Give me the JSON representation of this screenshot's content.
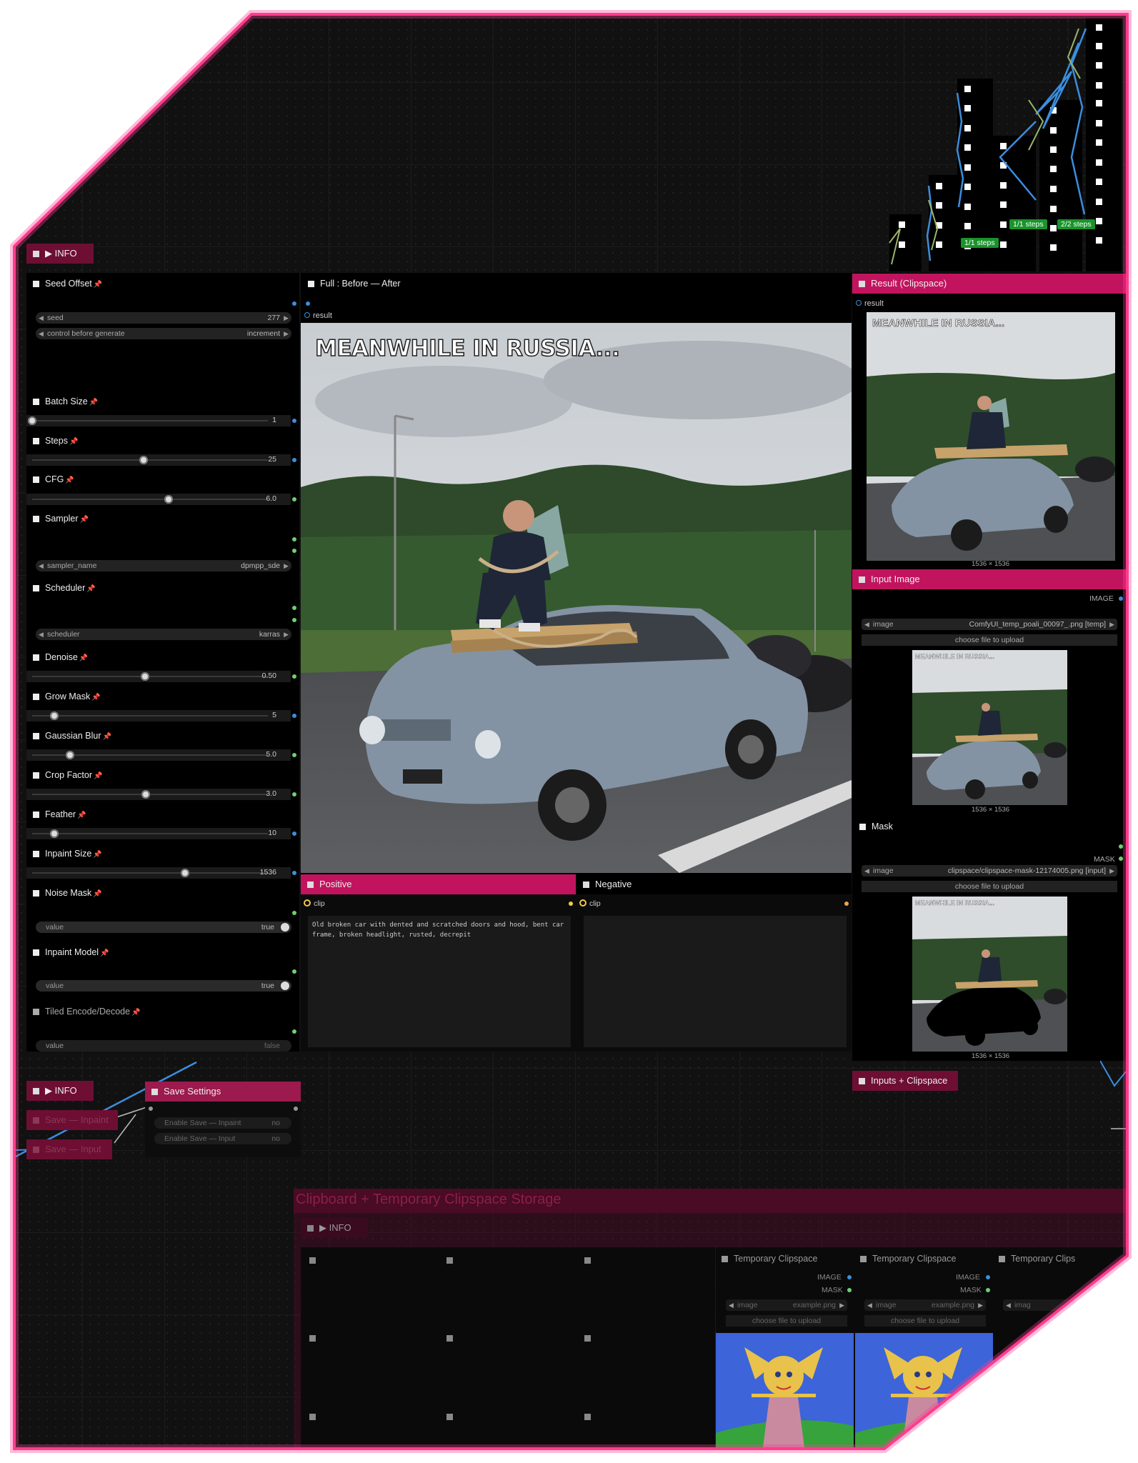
{
  "top_info": {
    "label": "▶ INFO"
  },
  "steps_badges": [
    "1/1 steps",
    "1/1 steps",
    "2/2 steps"
  ],
  "settings": {
    "seed_offset": {
      "title": "Seed Offset",
      "seed_label": "seed",
      "seed_value": "277",
      "control_label": "control before generate",
      "control_value": "increment"
    },
    "batch_size": {
      "title": "Batch Size",
      "value": "1",
      "fraction": 0.0
    },
    "steps": {
      "title": "Steps",
      "value": "25",
      "fraction": 0.49
    },
    "cfg": {
      "title": "CFG",
      "value": "6.0",
      "fraction": 0.6
    },
    "sampler": {
      "title": "Sampler",
      "field_label": "sampler_name",
      "value": "dpmpp_sde"
    },
    "scheduler": {
      "title": "Scheduler",
      "field_label": "scheduler",
      "value": "karras"
    },
    "denoise": {
      "title": "Denoise",
      "value": "0.50",
      "fraction": 0.5
    },
    "grow_mask": {
      "title": "Grow Mask",
      "value": "5",
      "fraction": 0.1
    },
    "gaussian_blur": {
      "title": "Gaussian Blur",
      "value": "5.0",
      "fraction": 0.17
    },
    "crop_factor": {
      "title": "Crop Factor",
      "value": "3.0",
      "fraction": 0.51
    },
    "feather": {
      "title": "Feather",
      "value": "10",
      "fraction": 0.1
    },
    "inpaint_size": {
      "title": "Inpaint Size",
      "value": "1536",
      "fraction": 0.68
    },
    "noise_mask": {
      "title": "Noise Mask",
      "field_label": "value",
      "value": "true"
    },
    "inpaint_model": {
      "title": "Inpaint Model",
      "field_label": "value",
      "value": "true"
    },
    "tiled_encode": {
      "title": "Tiled Encode/Decode",
      "field_label": "value",
      "value": "false"
    }
  },
  "compare": {
    "title": "Full : Before — After",
    "output": "result",
    "caption": "MEANWHILE IN RUSSIA..."
  },
  "result": {
    "title": "Result (Clipspace)",
    "output": "result",
    "caption": "MEANWHILE IN RUSSIA...",
    "size": "1536 × 1536"
  },
  "input_image": {
    "title": "Input Image",
    "output": "IMAGE",
    "field_label": "image",
    "file": "ComfyUI_temp_poali_00097_.png [temp]",
    "upload": "choose file to upload",
    "caption": "MEANWHILE IN RUSSIA...",
    "size": "1536 × 1536"
  },
  "mask": {
    "title": "Mask",
    "output": "MASK",
    "field_label": "image",
    "file": "clipspace/clipspace-mask-12174005.png [input]",
    "upload": "choose file to upload",
    "caption": "MEANWHILE IN RUSSIA...",
    "size": "1536 × 1536"
  },
  "positive": {
    "title": "Positive",
    "input": "clip",
    "text": "Old broken car with dented and scratched doors and hood, bent car frame, broken headlight, rusted, decrepit"
  },
  "negative": {
    "title": "Negative",
    "input": "clip",
    "text": ""
  },
  "bottom_left": {
    "info": "▶ INFO",
    "save_inpaint": "Save — Inpaint",
    "save_input": "Save — Input",
    "save_settings": "Save Settings",
    "enable_inpaint_label": "Enable Save — Inpaint",
    "enable_inpaint_value": "no",
    "enable_input_label": "Enable Save — Input",
    "enable_input_value": "no"
  },
  "inputs_clipspace": "Inputs + Clipspace",
  "clipboard_group": {
    "title": "Clipboard + Temporary Clipspace Storage",
    "info": "▶ INFO"
  },
  "temp_clipspace": [
    {
      "title": "Temporary Clipspace",
      "out_image": "IMAGE",
      "out_mask": "MASK",
      "field_label": "image",
      "file": "example.png",
      "upload": "choose file to upload"
    },
    {
      "title": "Temporary Clipspace",
      "out_image": "IMAGE",
      "out_mask": "MASK",
      "field_label": "image",
      "file": "example.png",
      "upload": "choose file to upload"
    },
    {
      "title": "Temporary Clips",
      "out_image": "",
      "out_mask": "",
      "field_label": "imag",
      "file": "",
      "upload": ""
    }
  ]
}
